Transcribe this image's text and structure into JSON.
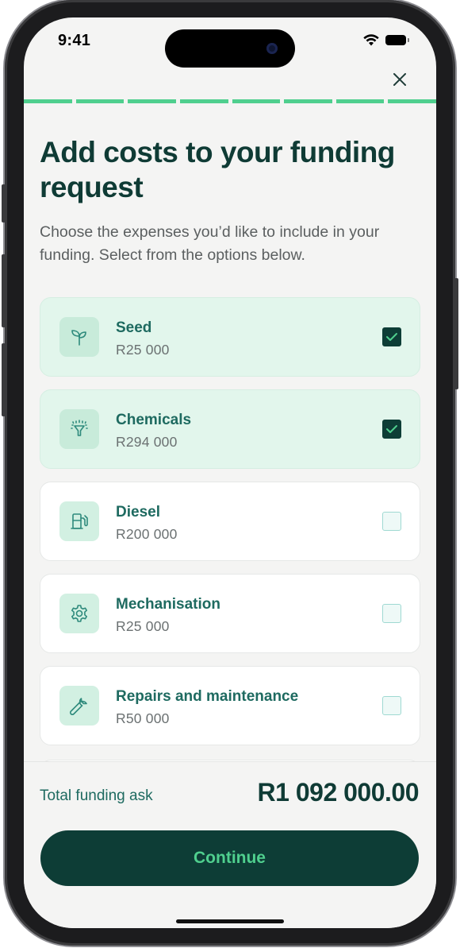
{
  "status_bar": {
    "time": "9:41",
    "wifi_icon": "wifi-icon",
    "battery_icon": "battery-icon"
  },
  "header": {
    "close_icon": "close-icon",
    "progress_steps_total": 8,
    "progress_steps_completed": 8
  },
  "main": {
    "title": "Add costs to your funding request",
    "subtitle": "Choose the expenses you’d like to include in your funding. Select from the options below."
  },
  "cost_items": [
    {
      "name": "Seed",
      "price": "R25 000",
      "icon": "sprout-icon",
      "checked": true
    },
    {
      "name": "Chemicals",
      "price": "R294 000",
      "icon": "sprayer-icon",
      "checked": true
    },
    {
      "name": "Diesel",
      "price": "R200 000",
      "icon": "fuel-pump-icon",
      "checked": false
    },
    {
      "name": "Mechanisation",
      "price": "R25 000",
      "icon": "gear-icon",
      "checked": false
    },
    {
      "name": "Repairs and maintenance",
      "price": "R50 000",
      "icon": "wrench-icon",
      "checked": false
    }
  ],
  "footer": {
    "total_label": "Total funding ask",
    "total_value": "R1 092 000.00",
    "continue_label": "Continue"
  },
  "colors": {
    "primary_dark": "#0d3d36",
    "accent_green": "#4fcf8e",
    "selected_bg": "#e2f6ec",
    "heading": "#0f3b35",
    "item_label": "#1e6a60"
  }
}
